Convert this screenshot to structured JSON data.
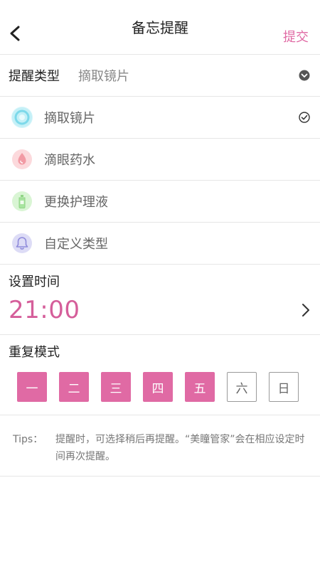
{
  "header": {
    "title": "备忘提醒",
    "submit_label": "提交"
  },
  "reminder_type": {
    "label": "提醒类型",
    "selected": "摘取镜片",
    "options": [
      {
        "label": "摘取镜片",
        "icon": "contact-lens-icon",
        "color": "#7dd9ea",
        "selected": true
      },
      {
        "label": "滴眼药水",
        "icon": "eye-drop-icon",
        "color": "#f29aa4",
        "selected": false
      },
      {
        "label": "更换护理液",
        "icon": "solution-bottle-icon",
        "color": "#a8e4a0",
        "selected": false
      },
      {
        "label": "自定义类型",
        "icon": "bell-icon",
        "color": "#a9a6e3",
        "selected": false
      }
    ]
  },
  "time": {
    "label": "设置时间",
    "value": "21:00"
  },
  "repeat": {
    "label": "重复模式",
    "days": [
      {
        "label": "一",
        "active": true
      },
      {
        "label": "二",
        "active": true
      },
      {
        "label": "三",
        "active": true
      },
      {
        "label": "四",
        "active": true
      },
      {
        "label": "五",
        "active": true
      },
      {
        "label": "六",
        "active": false
      },
      {
        "label": "日",
        "active": false
      }
    ]
  },
  "tips": {
    "label": "Tips：",
    "text": "提醒时，可选择稍后再提醒。“美瞳管家”会在相应设定时间再次提醒。"
  },
  "colors": {
    "accent": "#e06aa4",
    "time_text": "#d55e9a"
  }
}
